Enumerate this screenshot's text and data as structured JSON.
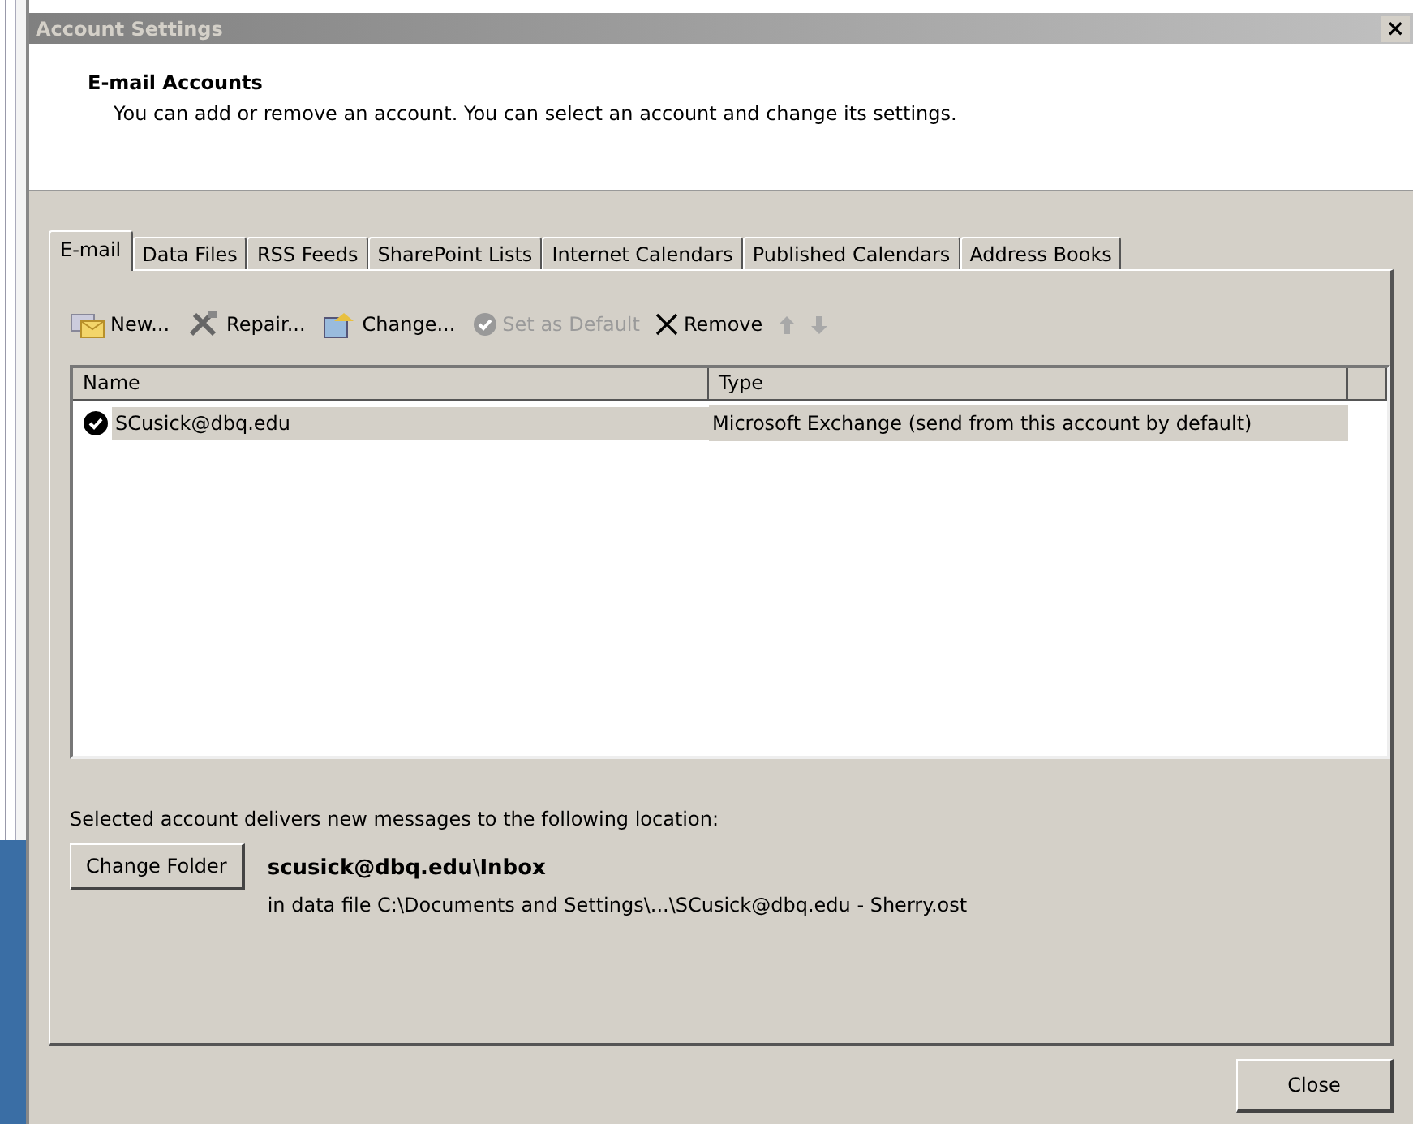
{
  "window": {
    "title": "Account Settings",
    "close": "×"
  },
  "header": {
    "title": "E-mail Accounts",
    "description": "You can add or remove an account. You can select an account and change its settings."
  },
  "tabs": [
    {
      "label": "E-mail",
      "selected": true
    },
    {
      "label": "Data Files",
      "selected": false
    },
    {
      "label": "RSS Feeds",
      "selected": false
    },
    {
      "label": "SharePoint Lists",
      "selected": false
    },
    {
      "label": "Internet Calendars",
      "selected": false
    },
    {
      "label": "Published Calendars",
      "selected": false
    },
    {
      "label": "Address Books",
      "selected": false
    }
  ],
  "toolbar": [
    {
      "kind": "new",
      "label": "New...",
      "disabled": false
    },
    {
      "kind": "repair",
      "label": "Repair...",
      "disabled": false
    },
    {
      "kind": "change",
      "label": "Change...",
      "disabled": false
    },
    {
      "kind": "default",
      "label": "Set as Default",
      "disabled": true
    },
    {
      "kind": "remove",
      "label": "Remove",
      "disabled": false
    },
    {
      "kind": "up",
      "disabled": true
    },
    {
      "kind": "down",
      "disabled": true
    }
  ],
  "table": {
    "columns": [
      "Name",
      "Type"
    ],
    "rows": [
      {
        "name": "SCusick@dbq.edu",
        "type": "Microsoft Exchange (send from this account by default)",
        "selected": true,
        "default": true
      }
    ]
  },
  "delivery": {
    "label": "Selected account delivers new messages to the following location:",
    "button": "Change Folder",
    "location": "**scusick@dbq.edu**\\**Inbox**",
    "data_file": "in data file C:\\Documents and Settings\\...\\SCusick@dbq.edu - Sherry.ost"
  },
  "buttons": [
    "Close"
  ]
}
